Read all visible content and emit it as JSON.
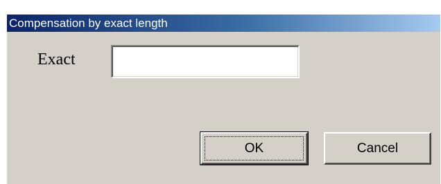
{
  "dialog": {
    "title": "Compensation by exact length",
    "field_label": "Exact",
    "field_value": "",
    "ok_label": "OK",
    "cancel_label": "Cancel"
  }
}
